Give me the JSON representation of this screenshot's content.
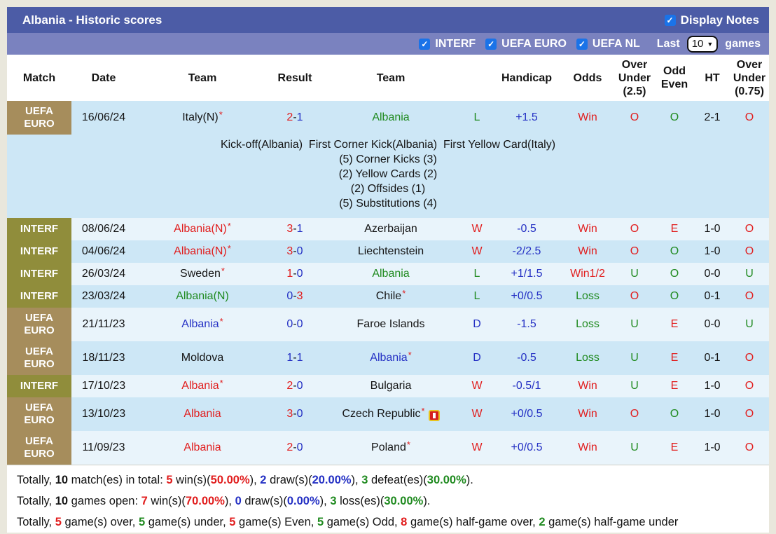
{
  "title_bar": {
    "title": "Albania - Historic scores",
    "display_notes_label": "Display Notes"
  },
  "filter_bar": {
    "competitions": [
      "INTERF",
      "UEFA EURO",
      "UEFA NL"
    ],
    "last_label": "Last",
    "games_label": "games",
    "selected_count": "10"
  },
  "colors": {
    "red": "#e11d1d",
    "blue": "#2430c4",
    "green": "#1f8a1f",
    "black": "#141414",
    "tan": "#a68d5c",
    "olive": "#908d3b",
    "row_odd": "#cde7f6",
    "row_even": "#e9f4fb",
    "bar1": "#4c5ca6",
    "bar2": "#7a82bf",
    "checkbox_blue": "#1a73e8"
  },
  "table": {
    "columns": [
      "Match",
      "Date",
      "Team",
      "Result",
      "Team",
      "",
      "Handicap",
      "Odds",
      "Over\nUnder\n(2.5)",
      "Odd\nEven",
      "HT",
      "Over\nUnder\n(0.75)"
    ],
    "rows": [
      {
        "match": "UEFA EURO",
        "match_style": "tan",
        "tall": true,
        "date": "16/06/24",
        "home": {
          "name": "Italy(N)",
          "color": "black",
          "star": true
        },
        "score": {
          "home": "2",
          "away": "1",
          "home_color": "red",
          "away_color": "blue"
        },
        "away": {
          "name": "Albania",
          "color": "green",
          "star": false
        },
        "wdl": {
          "t": "L",
          "c": "green"
        },
        "handicap": "+1.5",
        "odds": {
          "t": "Win",
          "c": "red"
        },
        "ou25": {
          "t": "O",
          "c": "red"
        },
        "odd_even": {
          "t": "O",
          "c": "green"
        },
        "ht": "2-1",
        "ou075": {
          "t": "O",
          "c": "red"
        },
        "notes": [
          "Kick-off(Albania)  First Corner Kick(Albania)  First Yellow Card(Italy)",
          "(5) Corner Kicks (3)",
          "(2) Yellow Cards (2)",
          "(2) Offsides (1)",
          "(5) Substitutions (4)"
        ]
      },
      {
        "match": "INTERF",
        "match_style": "olive",
        "tall": false,
        "date": "08/06/24",
        "home": {
          "name": "Albania(N)",
          "color": "red",
          "star": true
        },
        "score": {
          "home": "3",
          "away": "1",
          "home_color": "red",
          "away_color": "blue"
        },
        "away": {
          "name": "Azerbaijan",
          "color": "black",
          "star": false
        },
        "wdl": {
          "t": "W",
          "c": "red"
        },
        "handicap": "-0.5",
        "odds": {
          "t": "Win",
          "c": "red"
        },
        "ou25": {
          "t": "O",
          "c": "red"
        },
        "odd_even": {
          "t": "E",
          "c": "red"
        },
        "ht": "1-0",
        "ou075": {
          "t": "O",
          "c": "red"
        }
      },
      {
        "match": "INTERF",
        "match_style": "olive",
        "tall": false,
        "date": "04/06/24",
        "home": {
          "name": "Albania(N)",
          "color": "red",
          "star": true
        },
        "score": {
          "home": "3",
          "away": "0",
          "home_color": "red",
          "away_color": "blue"
        },
        "away": {
          "name": "Liechtenstein",
          "color": "black",
          "star": false
        },
        "wdl": {
          "t": "W",
          "c": "red"
        },
        "handicap": "-2/2.5",
        "odds": {
          "t": "Win",
          "c": "red"
        },
        "ou25": {
          "t": "O",
          "c": "red"
        },
        "odd_even": {
          "t": "O",
          "c": "green"
        },
        "ht": "1-0",
        "ou075": {
          "t": "O",
          "c": "red"
        }
      },
      {
        "match": "INTERF",
        "match_style": "olive",
        "tall": false,
        "date": "26/03/24",
        "home": {
          "name": "Sweden",
          "color": "black",
          "star": true
        },
        "score": {
          "home": "1",
          "away": "0",
          "home_color": "red",
          "away_color": "blue"
        },
        "away": {
          "name": "Albania",
          "color": "green",
          "star": false
        },
        "wdl": {
          "t": "L",
          "c": "green"
        },
        "handicap": "+1/1.5",
        "odds": {
          "t": "Win1/2",
          "c": "red"
        },
        "ou25": {
          "t": "U",
          "c": "green"
        },
        "odd_even": {
          "t": "O",
          "c": "green"
        },
        "ht": "0-0",
        "ou075": {
          "t": "U",
          "c": "green"
        }
      },
      {
        "match": "INTERF",
        "match_style": "olive",
        "tall": false,
        "date": "23/03/24",
        "home": {
          "name": "Albania(N)",
          "color": "green",
          "star": false
        },
        "score": {
          "home": "0",
          "away": "3",
          "home_color": "blue",
          "away_color": "red"
        },
        "away": {
          "name": "Chile",
          "color": "black",
          "star": true
        },
        "wdl": {
          "t": "L",
          "c": "green"
        },
        "handicap": "+0/0.5",
        "odds": {
          "t": "Loss",
          "c": "green"
        },
        "ou25": {
          "t": "O",
          "c": "red"
        },
        "odd_even": {
          "t": "O",
          "c": "green"
        },
        "ht": "0-1",
        "ou075": {
          "t": "O",
          "c": "red"
        }
      },
      {
        "match": "UEFA EURO",
        "match_style": "tan",
        "tall": true,
        "date": "21/11/23",
        "home": {
          "name": "Albania",
          "color": "blue",
          "star": true
        },
        "score": {
          "home": "0",
          "away": "0",
          "home_color": "blue",
          "away_color": "blue"
        },
        "away": {
          "name": "Faroe Islands",
          "color": "black",
          "star": false
        },
        "wdl": {
          "t": "D",
          "c": "blue"
        },
        "handicap": "-1.5",
        "odds": {
          "t": "Loss",
          "c": "green"
        },
        "ou25": {
          "t": "U",
          "c": "green"
        },
        "odd_even": {
          "t": "E",
          "c": "red"
        },
        "ht": "0-0",
        "ou075": {
          "t": "U",
          "c": "green"
        }
      },
      {
        "match": "UEFA EURO",
        "match_style": "tan",
        "tall": true,
        "date": "18/11/23",
        "home": {
          "name": "Moldova",
          "color": "black",
          "star": false
        },
        "score": {
          "home": "1",
          "away": "1",
          "home_color": "blue",
          "away_color": "blue"
        },
        "away": {
          "name": "Albania",
          "color": "blue",
          "star": true
        },
        "wdl": {
          "t": "D",
          "c": "blue"
        },
        "handicap": "-0.5",
        "odds": {
          "t": "Loss",
          "c": "green"
        },
        "ou25": {
          "t": "U",
          "c": "green"
        },
        "odd_even": {
          "t": "E",
          "c": "red"
        },
        "ht": "0-1",
        "ou075": {
          "t": "O",
          "c": "red"
        }
      },
      {
        "match": "INTERF",
        "match_style": "olive",
        "tall": false,
        "date": "17/10/23",
        "home": {
          "name": "Albania",
          "color": "red",
          "star": true
        },
        "score": {
          "home": "2",
          "away": "0",
          "home_color": "red",
          "away_color": "blue"
        },
        "away": {
          "name": "Bulgaria",
          "color": "black",
          "star": false
        },
        "wdl": {
          "t": "W",
          "c": "red"
        },
        "handicap": "-0.5/1",
        "odds": {
          "t": "Win",
          "c": "red"
        },
        "ou25": {
          "t": "U",
          "c": "green"
        },
        "odd_even": {
          "t": "E",
          "c": "red"
        },
        "ht": "1-0",
        "ou075": {
          "t": "O",
          "c": "red"
        }
      },
      {
        "match": "UEFA EURO",
        "match_style": "tan",
        "tall": true,
        "date": "13/10/23",
        "home": {
          "name": "Albania",
          "color": "red",
          "star": false
        },
        "score": {
          "home": "3",
          "away": "0",
          "home_color": "red",
          "away_color": "blue"
        },
        "away": {
          "name": "Czech Republic",
          "color": "black",
          "star": true,
          "icon": "red-card"
        },
        "wdl": {
          "t": "W",
          "c": "red"
        },
        "handicap": "+0/0.5",
        "odds": {
          "t": "Win",
          "c": "red"
        },
        "ou25": {
          "t": "O",
          "c": "red"
        },
        "odd_even": {
          "t": "O",
          "c": "green"
        },
        "ht": "1-0",
        "ou075": {
          "t": "O",
          "c": "red"
        }
      },
      {
        "match": "UEFA EURO",
        "match_style": "tan",
        "tall": true,
        "date": "11/09/23",
        "home": {
          "name": "Albania",
          "color": "red",
          "star": false
        },
        "score": {
          "home": "2",
          "away": "0",
          "home_color": "red",
          "away_color": "blue"
        },
        "away": {
          "name": "Poland",
          "color": "black",
          "star": true
        },
        "wdl": {
          "t": "W",
          "c": "red"
        },
        "handicap": "+0/0.5",
        "odds": {
          "t": "Win",
          "c": "red"
        },
        "ou25": {
          "t": "U",
          "c": "green"
        },
        "odd_even": {
          "t": "E",
          "c": "red"
        },
        "ht": "1-0",
        "ou075": {
          "t": "O",
          "c": "red"
        }
      }
    ]
  },
  "footer": {
    "lines": [
      [
        {
          "t": "Totally, "
        },
        {
          "t": "10",
          "b": 1
        },
        {
          "t": " match(es) in total: "
        },
        {
          "t": "5",
          "c": "red",
          "b": 1
        },
        {
          "t": " win(s)("
        },
        {
          "t": "50.00%",
          "c": "red",
          "b": 1
        },
        {
          "t": "), "
        },
        {
          "t": "2",
          "c": "blue",
          "b": 1
        },
        {
          "t": " draw(s)("
        },
        {
          "t": "20.00%",
          "c": "blue",
          "b": 1
        },
        {
          "t": "), "
        },
        {
          "t": "3",
          "c": "green",
          "b": 1
        },
        {
          "t": " defeat(es)("
        },
        {
          "t": "30.00%",
          "c": "green",
          "b": 1
        },
        {
          "t": ")."
        }
      ],
      [
        {
          "t": "Totally, "
        },
        {
          "t": "10",
          "b": 1
        },
        {
          "t": " games open: "
        },
        {
          "t": "7",
          "c": "red",
          "b": 1
        },
        {
          "t": " win(s)("
        },
        {
          "t": "70.00%",
          "c": "red",
          "b": 1
        },
        {
          "t": "), "
        },
        {
          "t": "0",
          "c": "blue",
          "b": 1
        },
        {
          "t": " draw(s)("
        },
        {
          "t": "0.00%",
          "c": "blue",
          "b": 1
        },
        {
          "t": "), "
        },
        {
          "t": "3",
          "c": "green",
          "b": 1
        },
        {
          "t": " loss(es)("
        },
        {
          "t": "30.00%",
          "c": "green",
          "b": 1
        },
        {
          "t": ")."
        }
      ],
      [
        {
          "t": "Totally, "
        },
        {
          "t": "5",
          "c": "red",
          "b": 1
        },
        {
          "t": " game(s) over, "
        },
        {
          "t": "5",
          "c": "green",
          "b": 1
        },
        {
          "t": " game(s) under, "
        },
        {
          "t": "5",
          "c": "red",
          "b": 1
        },
        {
          "t": " game(s) Even, "
        },
        {
          "t": "5",
          "c": "green",
          "b": 1
        },
        {
          "t": " game(s) Odd, "
        },
        {
          "t": "8",
          "c": "red",
          "b": 1
        },
        {
          "t": " game(s) half-game over, "
        },
        {
          "t": "2",
          "c": "green",
          "b": 1
        },
        {
          "t": " game(s) half-game under"
        }
      ]
    ]
  }
}
